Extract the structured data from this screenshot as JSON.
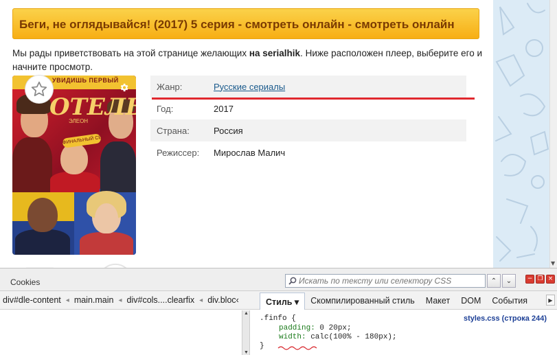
{
  "page": {
    "title": "Беги, не оглядывайся! (2017) 5 серия - смотреть онлайн - смотреть онлайн",
    "intro_before": "Мы рады приветствовать на этой странице желающих ",
    "intro_bold": "на serialhik",
    "intro_after": ". Ниже расположен плеер, выберите его и начните просмотр.",
    "poster": {
      "tagline": "УВИДИШЬ ПЕРВЫЙ",
      "logo": "ОТЕЛЬ",
      "subtitle": "ЭЛЕОН",
      "season_badge": "ФИНАЛЬНЫЙ СЕЗОН"
    },
    "info": [
      {
        "label": "Жанр:",
        "value": "Русские сериалы",
        "is_link": true
      },
      {
        "label": "Год:",
        "value": "2017",
        "is_link": false
      },
      {
        "label": "Страна:",
        "value": "Россия",
        "is_link": false
      },
      {
        "label": "Режиссер:",
        "value": "Мирослав Малич",
        "is_link": false
      }
    ],
    "colors": {
      "banner": "#f7ae14",
      "banner_text": "#7a3a02",
      "link": "#1a5a8c",
      "underline_annotation": "#e0282e"
    }
  },
  "devtools": {
    "title": "Cookies",
    "search_placeholder": "Искать по тексту или селектору CSS",
    "breadcrumbs": [
      "div#dle-content",
      "main.main",
      "div#cols....clearfix",
      "div.bloc‹"
    ],
    "tabs": [
      "Стиль ▾",
      "Скомпилированный стиль",
      "Макет",
      "DOM",
      "События"
    ],
    "css_source": "styles.css (строка 244)",
    "css": {
      "selector": ".finfo {",
      "padding_prop": "padding:",
      "padding_val": " 0 20px;",
      "width_prop": "width:",
      "width_val": " calc(100% - 180px);",
      "close": "}"
    }
  }
}
